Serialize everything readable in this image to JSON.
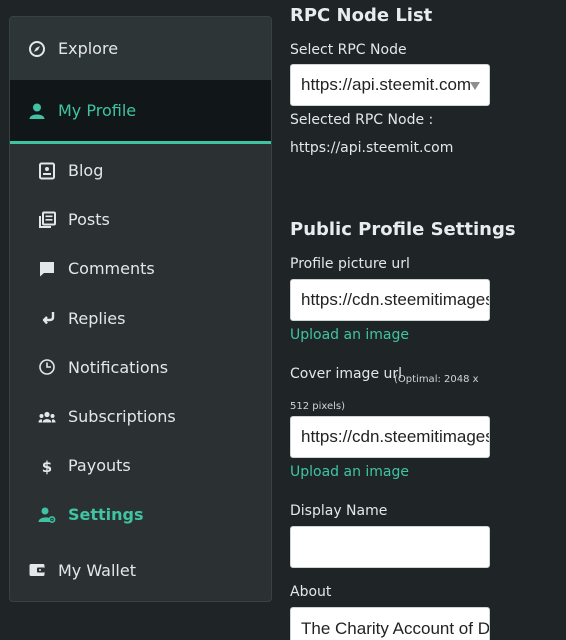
{
  "sidebar": {
    "explore": {
      "label": "Explore",
      "icon": "compass-icon"
    },
    "my_profile": {
      "label": "My Profile",
      "icon": "user-icon"
    },
    "sub_items": [
      {
        "label": "Blog",
        "icon": "blog-icon"
      },
      {
        "label": "Posts",
        "icon": "posts-icon"
      },
      {
        "label": "Comments",
        "icon": "comment-icon"
      },
      {
        "label": "Replies",
        "icon": "reply-icon"
      },
      {
        "label": "Notifications",
        "icon": "clock-icon"
      },
      {
        "label": "Subscriptions",
        "icon": "people-icon"
      },
      {
        "label": "Payouts",
        "icon": "dollar-icon"
      },
      {
        "label": "Settings",
        "icon": "user-gear-icon",
        "active": true
      }
    ],
    "my_wallet": {
      "label": "My Wallet",
      "icon": "wallet-icon"
    }
  },
  "rpc": {
    "title": "RPC Node List",
    "select_label": "Select RPC Node",
    "select_value": "https://api.steemit.com",
    "selected_label": "Selected RPC Node :",
    "selected_value": "https://api.steemit.com"
  },
  "profile": {
    "title": "Public Profile Settings",
    "picture_label": "Profile picture url",
    "picture_value": "https://cdn.steemitimages.com",
    "upload_1": "Upload an image",
    "cover_label": "Cover image url",
    "cover_hint": "(Optimal: 2048 x 512 pixels)",
    "cover_value": "https://cdn.steemitimages.com",
    "upload_2": "Upload an image",
    "display_name_label": "Display Name",
    "display_name_value": "",
    "about_label": "About",
    "about_value": "The Charity Account of D"
  },
  "colors": {
    "accent": "#3fc4a3",
    "background": "#1f2527",
    "panel": "#2b3133"
  }
}
